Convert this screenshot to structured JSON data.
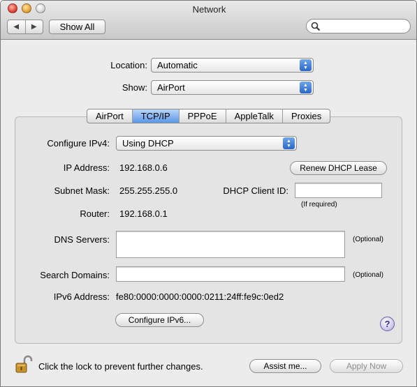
{
  "window": {
    "title": "Network"
  },
  "toolbar": {
    "back_glyph": "◀",
    "forward_glyph": "▶",
    "show_all_label": "Show All",
    "search": {
      "placeholder": "",
      "value": ""
    }
  },
  "location": {
    "label": "Location:",
    "value": "Automatic"
  },
  "show": {
    "label": "Show:",
    "value": "AirPort"
  },
  "tabs": [
    {
      "label": "AirPort",
      "selected": false
    },
    {
      "label": "TCP/IP",
      "selected": true
    },
    {
      "label": "PPPoE",
      "selected": false
    },
    {
      "label": "AppleTalk",
      "selected": false
    },
    {
      "label": "Proxies",
      "selected": false
    }
  ],
  "tcpip": {
    "configure_label": "Configure IPv4:",
    "configure_value": "Using DHCP",
    "ip_label": "IP Address:",
    "ip_value": "192.168.0.6",
    "renew_button": "Renew DHCP Lease",
    "subnet_label": "Subnet Mask:",
    "subnet_value": "255.255.255.0",
    "client_id_label": "DHCP Client ID:",
    "client_id_value": "",
    "client_id_hint": "(If required)",
    "router_label": "Router:",
    "router_value": "192.168.0.1",
    "dns_label": "DNS Servers:",
    "dns_value": "",
    "dns_hint": "(Optional)",
    "search_domains_label": "Search Domains:",
    "search_domains_value": "",
    "search_domains_hint": "(Optional)",
    "ipv6_label": "IPv6 Address:",
    "ipv6_value": "fe80:0000:0000:0000:0211:24ff:fe9c:0ed2",
    "configure_ipv6_button": "Configure IPv6...",
    "help_glyph": "?"
  },
  "footer": {
    "lock_text": "Click the lock to prevent further changes.",
    "assist_button": "Assist me...",
    "apply_button": "Apply Now"
  },
  "colors": {
    "accent": "#2a66c8",
    "tab_selected": "#5a97e6",
    "close": "#e0443a",
    "minimize": "#e8a43a",
    "lock_gold": "#c8922f"
  },
  "icons": [
    "close-icon",
    "minimize-icon",
    "zoom-icon",
    "back-icon",
    "forward-icon",
    "search-icon",
    "popup-arrows-icon",
    "help-icon",
    "lock-icon"
  ]
}
